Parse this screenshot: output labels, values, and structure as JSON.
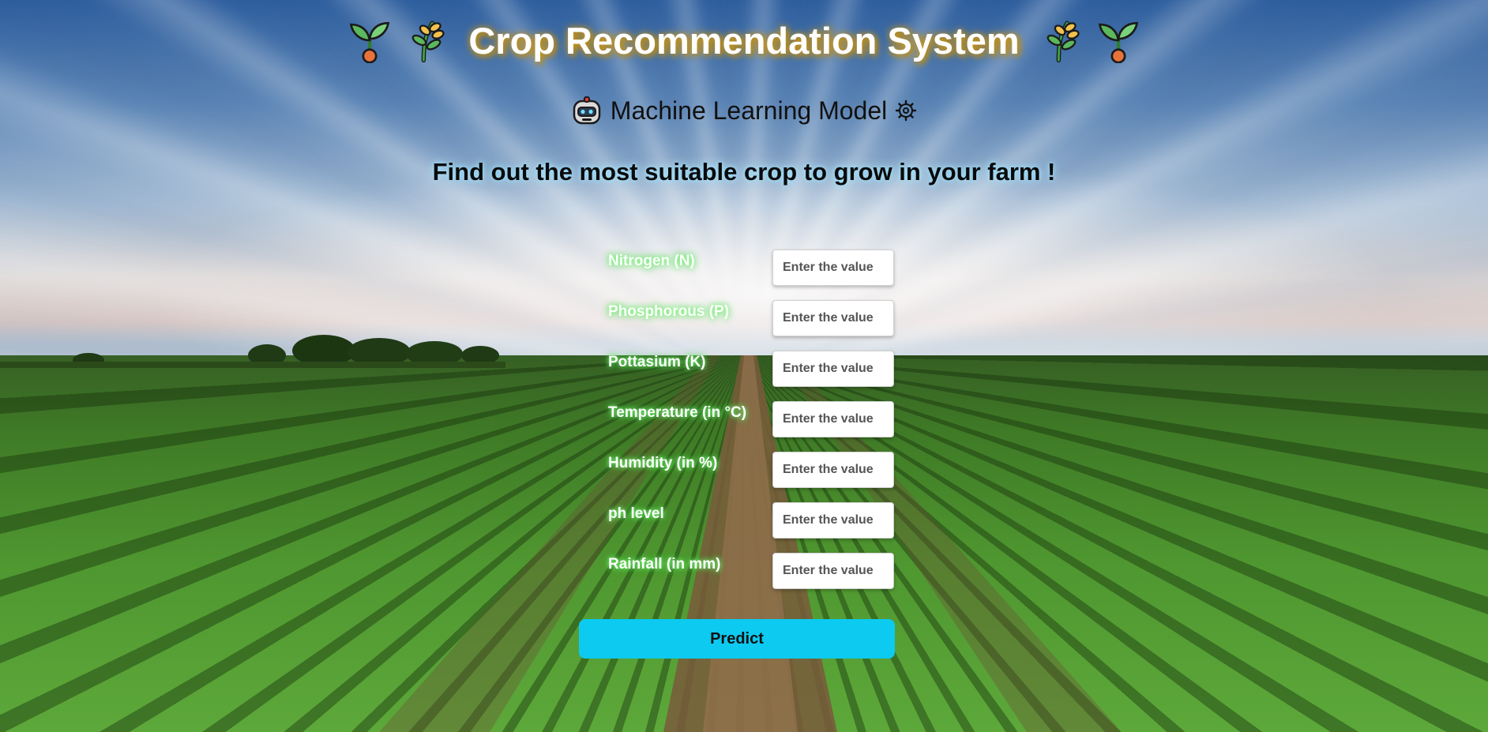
{
  "header": {
    "title": "Crop Recommendation System",
    "left_icons": [
      "seedling-icon",
      "wheat-sheaf-icon"
    ],
    "right_icons": [
      "wheat-sheaf-icon",
      "seedling-icon"
    ]
  },
  "subtitle": {
    "text": "Machine Learning Model",
    "left_icon": "robot-icon",
    "right_icon": "gear-icon"
  },
  "tagline": "Find out the most suitable crop to grow in your farm !",
  "form": {
    "fields": [
      {
        "label": "Nitrogen (N)",
        "placeholder": "Enter the value",
        "value": ""
      },
      {
        "label": "Phosphorous (P)",
        "placeholder": "Enter the value",
        "value": ""
      },
      {
        "label": "Pottasium (K)",
        "placeholder": "Enter the value",
        "value": ""
      },
      {
        "label": "Temperature (in °C)",
        "placeholder": "Enter the value",
        "value": ""
      },
      {
        "label": "Humidity (in %)",
        "placeholder": "Enter the value",
        "value": ""
      },
      {
        "label": "ph level",
        "placeholder": "Enter the value",
        "value": ""
      },
      {
        "label": "Rainfall (in mm)",
        "placeholder": "Enter the value",
        "value": ""
      }
    ],
    "submit_label": "Predict"
  },
  "colors": {
    "button": "#0dcaf0",
    "title_glow": "#d49b14",
    "label_glow": "#7cff7c",
    "tagline_glow": "#9fe3ff"
  }
}
